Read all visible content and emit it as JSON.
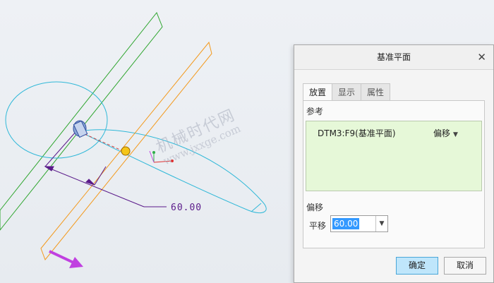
{
  "viewport": {
    "dimension_text": "60.00",
    "watermark_line1": "机械时代网",
    "watermark_line2": "www.jxxge.com",
    "colors": {
      "plane_dtm3": "#2ea52e",
      "plane_new": "#f39a1e",
      "circle": "#30b8d8",
      "dimension": "#5a1a8a",
      "arrow": "#c040e0",
      "drag_handle": "#f5c518"
    }
  },
  "dialog": {
    "title": "基准平面",
    "close_icon": "close-icon",
    "tabs": [
      {
        "label": "放置",
        "active": true
      },
      {
        "label": "显示",
        "active": false
      },
      {
        "label": "属性",
        "active": false
      }
    ],
    "references_label": "参考",
    "reference": {
      "item": "DTM3:F9(基准平面)",
      "constraint": "偏移"
    },
    "offset_section_label": "偏移",
    "translation_label": "平移",
    "translation_value": "60.00",
    "ok_label": "确定",
    "cancel_label": "取消"
  }
}
